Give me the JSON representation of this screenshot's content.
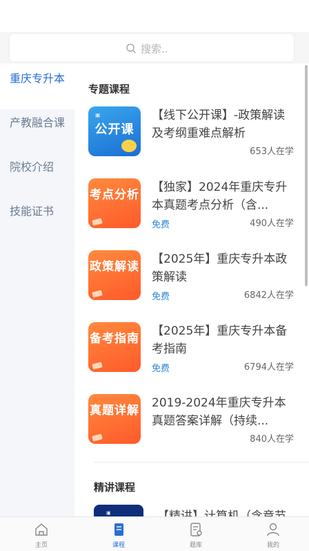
{
  "search": {
    "placeholder": "搜索.."
  },
  "sidebar": {
    "items": [
      {
        "label": "重庆专升本",
        "active": true
      },
      {
        "label": "产教融合课",
        "active": false
      },
      {
        "label": "院校介绍",
        "active": false
      },
      {
        "label": "技能证书",
        "active": false
      }
    ]
  },
  "main": {
    "section1_title": "专题课程",
    "courses": [
      {
        "thumb_text": "公开课",
        "thumb_color": "blue",
        "title": "【线下公开课】-政策解读及考纲重难点解析",
        "free": "",
        "count": "653人在学"
      },
      {
        "thumb_text": "考点分析",
        "thumb_color": "orange",
        "title": "【独家】2024年重庆专升本真题考点分析（含...",
        "free": "免费",
        "count": "490人在学"
      },
      {
        "thumb_text": "政策解读",
        "thumb_color": "orange",
        "title": "【2025年】重庆专升本政策解读",
        "free": "免费",
        "count": "6842人在学"
      },
      {
        "thumb_text": "备考指南",
        "thumb_color": "orange",
        "title": "【2025年】重庆专升本备考指南",
        "free": "免费",
        "count": "6794人在学"
      },
      {
        "thumb_text": "真题详解",
        "thumb_color": "orange",
        "title": "2019-2024年重庆专升本真题答案详解（持续...",
        "free": "",
        "count": "840人在学"
      }
    ],
    "section2_title": "精讲课程",
    "jingjiang_first_title": "【精讲】计算机（含章节"
  },
  "tabbar": {
    "tabs": [
      {
        "label": "主页",
        "icon": "home-icon",
        "active": false
      },
      {
        "label": "课程",
        "icon": "course-icon",
        "active": true
      },
      {
        "label": "题库",
        "icon": "question-bank-icon",
        "active": false
      },
      {
        "label": "我的",
        "icon": "user-icon",
        "active": false
      }
    ]
  },
  "colors": {
    "accent": "#2a6fd6",
    "free": "#2a87d6",
    "orange_thumb": "#ff6a30",
    "blue_thumb": "#2a8ae0"
  }
}
